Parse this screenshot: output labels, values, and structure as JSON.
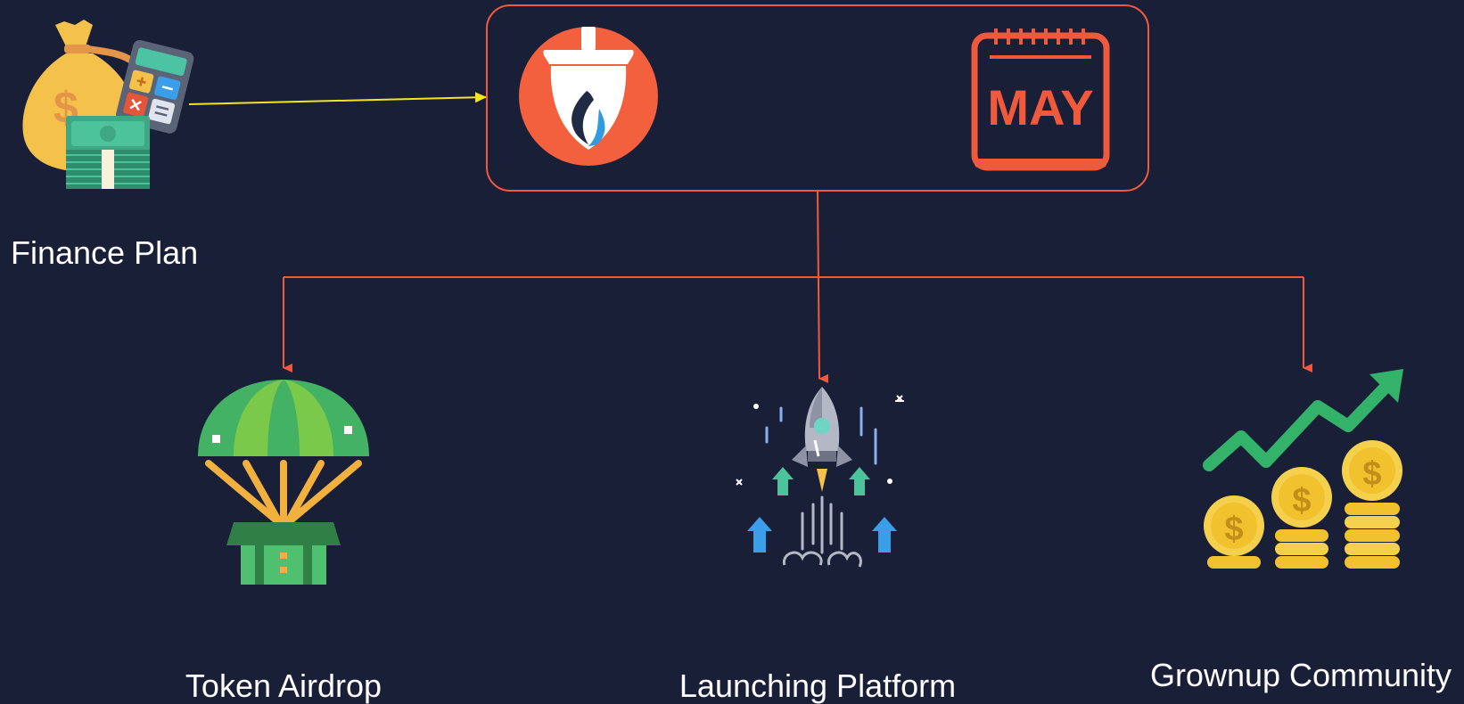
{
  "diagram": {
    "source_node": {
      "label": "Finance Plan",
      "icon": "money-bag-calculator-icon"
    },
    "hub_node": {
      "icons": [
        "flame-acorn-logo-icon",
        "calendar-icon"
      ],
      "calendar_month": "MAY"
    },
    "targets": [
      {
        "label": "Token Airdrop",
        "icon": "parachute-airdrop-icon"
      },
      {
        "label": "Launching Platform",
        "icon": "rocket-launch-icon"
      },
      {
        "label": "Grownup Community",
        "icon": "coins-growth-icon"
      }
    ]
  },
  "colors": {
    "background": "#1a1f38",
    "hub_border": "#ef5a3c",
    "connector_orange": "#ef5a3c",
    "connector_yellow": "#f5e61c",
    "text": "#ffffff"
  }
}
